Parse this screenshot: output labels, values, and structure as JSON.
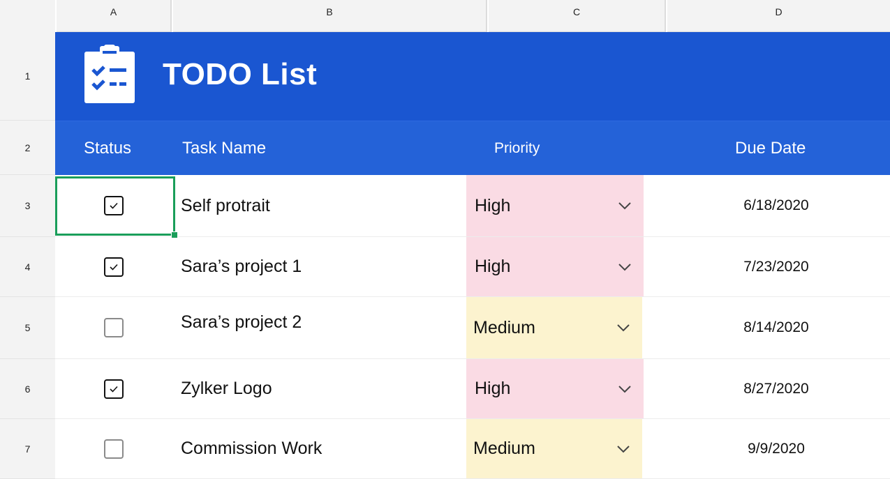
{
  "columns": [
    "A",
    "B",
    "C",
    "D"
  ],
  "rows": [
    "1",
    "2",
    "3",
    "4",
    "5",
    "6",
    "7"
  ],
  "banner": {
    "title": "TODO List",
    "icon": "clipboard-checklist-icon",
    "color": "#1a56d1"
  },
  "headers": {
    "status": "Status",
    "task": "Task Name",
    "priority": "Priority",
    "due": "Due Date"
  },
  "priority_colors": {
    "High": "#fadbe4",
    "Medium": "#fcf3cf"
  },
  "selection_color": "#1a9e5a",
  "tasks": [
    {
      "done": true,
      "name": "Self protrait",
      "priority": "High",
      "due": "6/18/2020"
    },
    {
      "done": true,
      "name": "Sara’s project 1",
      "priority": "High",
      "due": "7/23/2020"
    },
    {
      "done": false,
      "name": "Sara’s project 2",
      "priority": "Medium",
      "due": "8/14/2020"
    },
    {
      "done": true,
      "name": "Zylker Logo",
      "priority": "High",
      "due": "8/27/2020"
    },
    {
      "done": false,
      "name": "Commission Work",
      "priority": "Medium",
      "due": "9/9/2020"
    }
  ]
}
